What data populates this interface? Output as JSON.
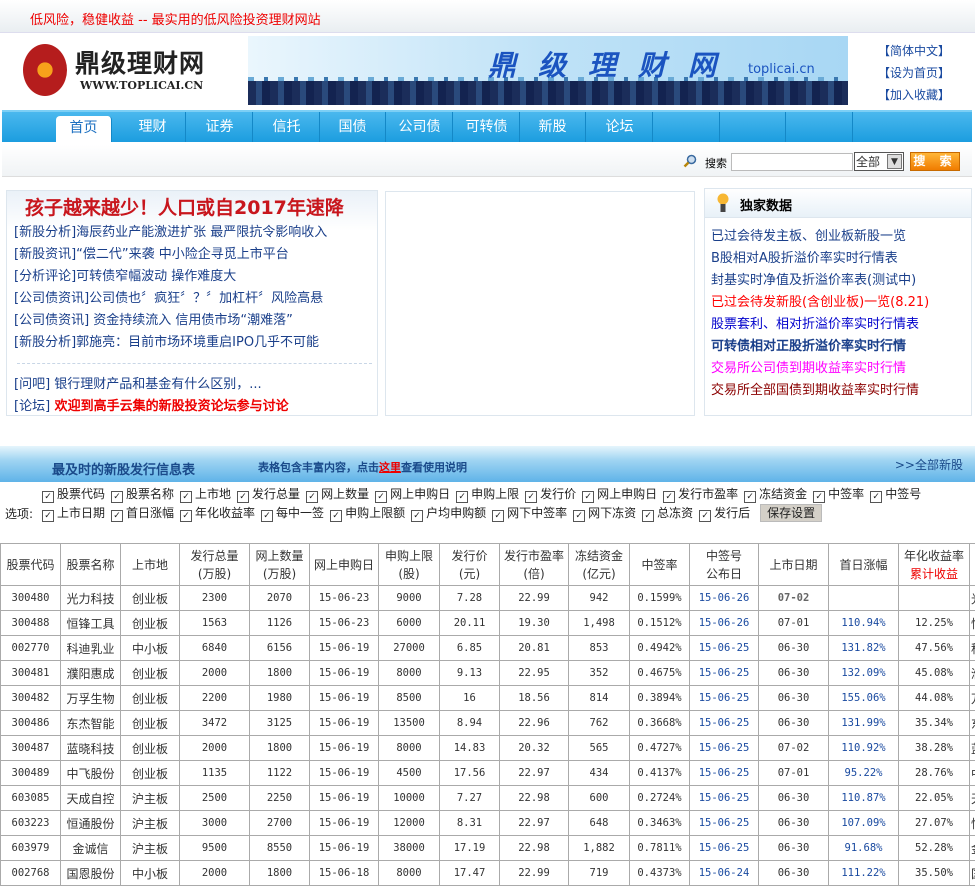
{
  "top_slogan": "低风险，稳健收益 -- 最实用的低风险投资理财网站",
  "logo": {
    "name": "鼎级理财网",
    "url": "WWW.TOPLICAI.CN"
  },
  "banner": {
    "title": "鼎级理财网",
    "url": "toplicai.cn"
  },
  "top_links": [
    "【简体中文】",
    "【设为首页】",
    "【加入收藏】"
  ],
  "nav": [
    "首页",
    "理财",
    "证券",
    "信托",
    "国债",
    "公司债",
    "可转债",
    "新股",
    "论坛"
  ],
  "search": {
    "label": "搜索",
    "value": "",
    "select": "全部",
    "button": "搜 索"
  },
  "news": {
    "headline": "孩子越来越少！人口或自2017年速降",
    "items": [
      {
        "tag": "[新股分析]",
        "text": "海辰药业产能激进扩张 最严限抗令影响收入"
      },
      {
        "tag": "[新股资讯]",
        "text": "“偿二代”来袭 中小险企寻觅上市平台"
      },
      {
        "tag": "[分析评论]",
        "text": "可转债窄幅波动 操作难度大"
      },
      {
        "tag": "[公司债资讯]",
        "text": "公司债也〞疯狂〞？〞加杠杆〞风险高悬"
      },
      {
        "tag": "[公司债资讯]",
        "text": " 资金持续流入 信用债市场“潮难落”"
      },
      {
        "tag": "[新股分析]",
        "text": "郭施亮：目前市场环境重启IPO几乎不可能"
      }
    ],
    "extra": [
      {
        "tag": "[问吧]",
        "text": " 银行理财产品和基金有什么区别，..."
      },
      {
        "tag": "[论坛]",
        "text": " 欢迎到高手云集的新股投资论坛参与讨论"
      }
    ]
  },
  "exclusive": {
    "title": "独家数据",
    "items": [
      {
        "text": "已过会待发主板、创业板新股一览",
        "color": "#1a3f8a"
      },
      {
        "text": "B股相对A股折溢价率实时行情表",
        "color": "#1a3f8a"
      },
      {
        "text": "封基实时净值及折溢价率表(测试中)",
        "color": "#1a3f8a"
      },
      {
        "text": "已过会待发新股(含创业板)一览(8.21)",
        "color": "#ff0000"
      },
      {
        "text": "股票套利、相对折溢价率实时行情表",
        "color": "#0000cc"
      },
      {
        "text": "可转债相对正股折溢价率实时行情",
        "color": "#1a3f8a",
        "bold": true
      },
      {
        "text": "交易所公司债到期收益率实时行情",
        "color": "#ff00ff"
      },
      {
        "text": "交易所全部国债到期收益率实时行情",
        "color": "#8b0000"
      }
    ]
  },
  "table_section": {
    "title": "最及时的新股发行信息表",
    "note_pre": "表格包含丰富内容，点击",
    "note_link": "这里",
    "note_post": "查看使用说明",
    "all_link": ">>全部新股",
    "options_label": "选项:",
    "options": [
      "股票代码",
      "股票名称",
      "上市地",
      "发行总量",
      "网上数量",
      "网上申购日",
      "申购上限",
      "发行价",
      "网上申购日",
      "发行市盈率",
      "冻结资金",
      "中签率",
      "中签号",
      "上市日期",
      "首日涨幅",
      "年化收益率",
      "每中一签",
      "申购上限额",
      "户均申购额",
      "网下中签率",
      "网下冻资",
      "总冻资",
      "发行后"
    ],
    "save": "保存设置"
  },
  "table": {
    "headers": [
      [
        "股票代码"
      ],
      [
        "股票名称"
      ],
      [
        "上市地"
      ],
      [
        "发行总量",
        "(万股)"
      ],
      [
        "网上数量",
        "(万股)"
      ],
      [
        "网上申购日"
      ],
      [
        "申购上限",
        "(股)"
      ],
      [
        "发行价",
        "(元)"
      ],
      [
        "发行市盈率",
        "(倍)"
      ],
      [
        "冻结资金",
        "(亿元)"
      ],
      [
        "中签率"
      ],
      [
        "中签号",
        "公布日"
      ],
      [
        "上市日期"
      ],
      [
        "首日涨幅"
      ],
      [
        "年化收益率",
        "累计收益"
      ],
      [
        "股"
      ]
    ],
    "rows": [
      [
        "300480",
        "光力科技",
        "创业板",
        "2300",
        "2070",
        "15-06-23",
        "9000",
        "7.28",
        "22.99",
        "942",
        "0.1599%",
        "15-06-26",
        "07-02",
        "",
        "",
        "光"
      ],
      [
        "300488",
        "恒锋工具",
        "创业板",
        "1563",
        "1126",
        "15-06-23",
        "6000",
        "20.11",
        "19.30",
        "1,498",
        "0.1512%",
        "15-06-26",
        "07-01",
        "110.94%",
        "12.25%",
        "恒"
      ],
      [
        "002770",
        "科迪乳业",
        "中小板",
        "6840",
        "6156",
        "15-06-19",
        "27000",
        "6.85",
        "20.81",
        "853",
        "0.4942%",
        "15-06-25",
        "06-30",
        "131.82%",
        "47.56%",
        "科"
      ],
      [
        "300481",
        "濮阳惠成",
        "创业板",
        "2000",
        "1800",
        "15-06-19",
        "8000",
        "9.13",
        "22.95",
        "352",
        "0.4675%",
        "15-06-25",
        "06-30",
        "132.09%",
        "45.08%",
        "濮"
      ],
      [
        "300482",
        "万孚生物",
        "创业板",
        "2200",
        "1980",
        "15-06-19",
        "8500",
        "16",
        "18.56",
        "814",
        "0.3894%",
        "15-06-25",
        "06-30",
        "155.06%",
        "44.08%",
        "万"
      ],
      [
        "300486",
        "东杰智能",
        "创业板",
        "3472",
        "3125",
        "15-06-19",
        "13500",
        "8.94",
        "22.96",
        "762",
        "0.3668%",
        "15-06-25",
        "06-30",
        "131.99%",
        "35.34%",
        "东"
      ],
      [
        "300487",
        "蓝晓科技",
        "创业板",
        "2000",
        "1800",
        "15-06-19",
        "8000",
        "14.83",
        "20.32",
        "565",
        "0.4727%",
        "15-06-25",
        "07-02",
        "110.92%",
        "38.28%",
        "蓝"
      ],
      [
        "300489",
        "中飞股份",
        "创业板",
        "1135",
        "1122",
        "15-06-19",
        "4500",
        "17.56",
        "22.97",
        "434",
        "0.4137%",
        "15-06-25",
        "07-01",
        "95.22%",
        "28.76%",
        "中"
      ],
      [
        "603085",
        "天成自控",
        "沪主板",
        "2500",
        "2250",
        "15-06-19",
        "10000",
        "7.27",
        "22.98",
        "600",
        "0.2724%",
        "15-06-25",
        "06-30",
        "110.87%",
        "22.05%",
        "天"
      ],
      [
        "603223",
        "恒通股份",
        "沪主板",
        "3000",
        "2700",
        "15-06-19",
        "12000",
        "8.31",
        "22.97",
        "648",
        "0.3463%",
        "15-06-25",
        "06-30",
        "107.09%",
        "27.07%",
        "恒"
      ],
      [
        "603979",
        "金诚信",
        "沪主板",
        "9500",
        "8550",
        "15-06-19",
        "38000",
        "17.19",
        "22.98",
        "1,882",
        "0.7811%",
        "15-06-25",
        "06-30",
        "91.68%",
        "52.28%",
        "金"
      ],
      [
        "002768",
        "国恩股份",
        "中小板",
        "2000",
        "1800",
        "15-06-18",
        "8000",
        "17.47",
        "22.99",
        "719",
        "0.4373%",
        "15-06-24",
        "06-30",
        "111.22%",
        "35.50%",
        "国"
      ]
    ]
  }
}
